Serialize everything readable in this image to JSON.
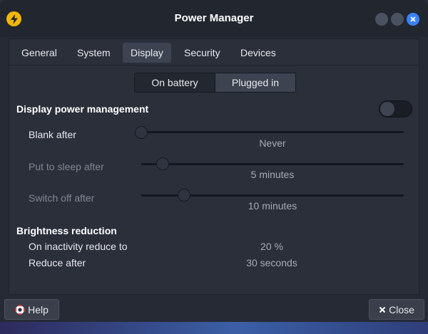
{
  "window": {
    "title": "Power Manager",
    "app_icon": "lightning-bolt-icon",
    "controls": [
      "minimize",
      "maximize",
      "close"
    ],
    "accent_color": "#3b82f6"
  },
  "tabs": [
    {
      "label": "General"
    },
    {
      "label": "System"
    },
    {
      "label": "Display",
      "active": true
    },
    {
      "label": "Security"
    },
    {
      "label": "Devices"
    }
  ],
  "mode_toggle": {
    "on_battery": "On battery",
    "plugged_in": "Plugged in",
    "selected": "Plugged in"
  },
  "display_power": {
    "title": "Display power management",
    "enabled": false,
    "rows": [
      {
        "label": "Blank after",
        "value": "Never",
        "level": 0.0
      },
      {
        "label": "Put to sleep after",
        "value": "5 minutes",
        "level": 0.08
      },
      {
        "label": "Switch off after",
        "value": "10 minutes",
        "level": 0.16
      }
    ]
  },
  "brightness": {
    "title": "Brightness reduction",
    "rows": [
      {
        "label": "On inactivity reduce to",
        "value": "20 %"
      },
      {
        "label": "Reduce after",
        "value": "30 seconds"
      }
    ]
  },
  "footer": {
    "help_label": "Help",
    "close_label": "Close"
  }
}
